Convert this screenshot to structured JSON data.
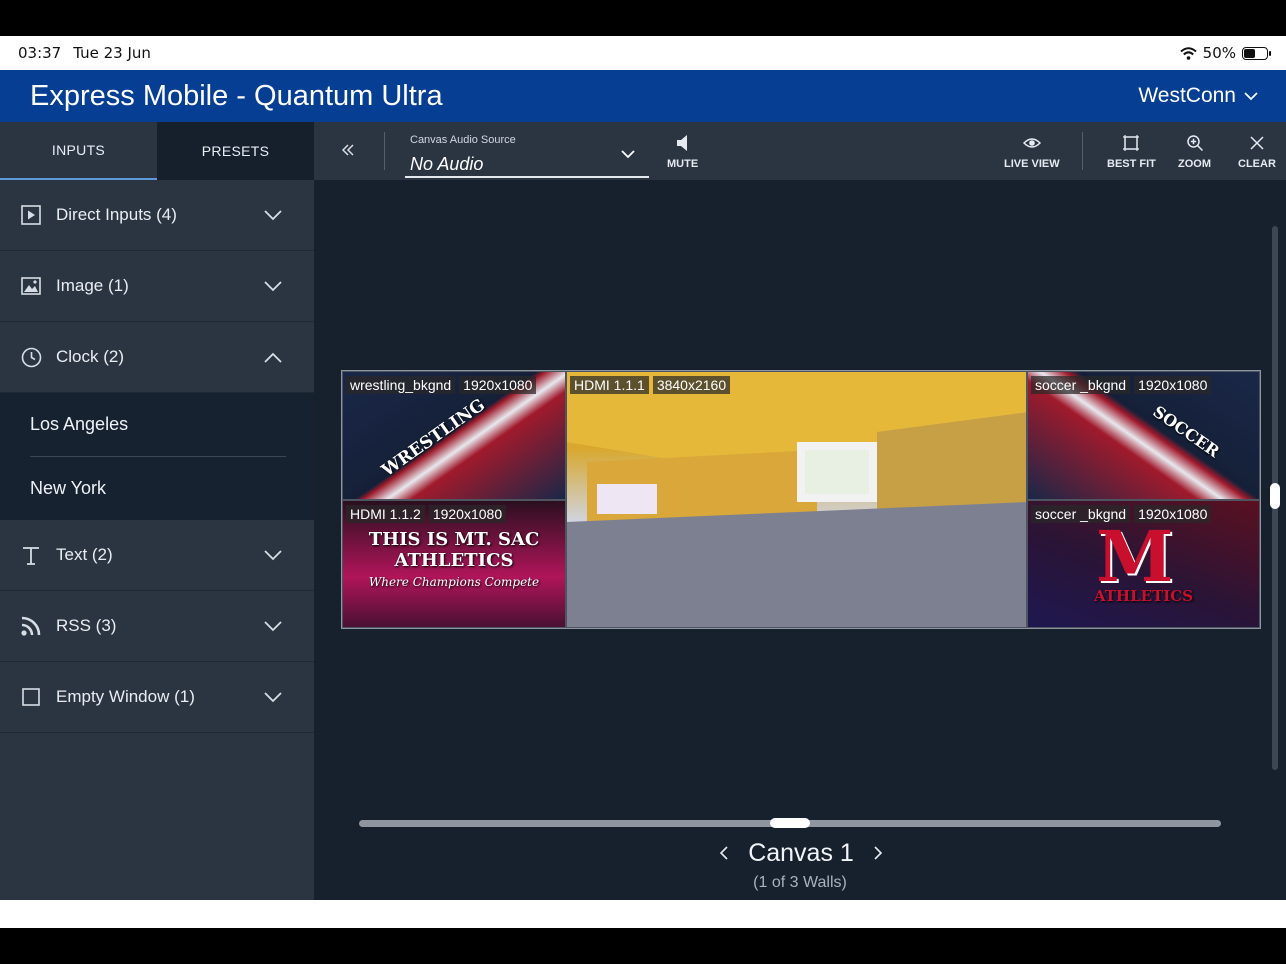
{
  "status": {
    "time": "03:37",
    "date": "Tue 23 Jun",
    "battery": "50%",
    "battery_level": 0.5
  },
  "app": {
    "title": "Express Mobile - Quantum Ultra",
    "account": "WestConn"
  },
  "tabs": [
    {
      "label": "INPUTS",
      "active": true
    },
    {
      "label": "PRESETS",
      "active": false
    }
  ],
  "categories": [
    {
      "label": "Direct Inputs (4)",
      "icon": "play-box-icon",
      "expanded": false
    },
    {
      "label": "Image (1)",
      "icon": "image-icon",
      "expanded": false
    },
    {
      "label": "Clock (2)",
      "icon": "clock-icon",
      "expanded": true,
      "items": [
        "Los Angeles",
        "New York"
      ]
    },
    {
      "label": "Text (2)",
      "icon": "text-icon",
      "expanded": false
    },
    {
      "label": "RSS (3)",
      "icon": "rss-icon",
      "expanded": false
    },
    {
      "label": "Empty Window (1)",
      "icon": "empty-window-icon",
      "expanded": false
    }
  ],
  "toolbar": {
    "audio_label": "Canvas Audio Source",
    "audio_value": "No Audio",
    "mute": "MUTE",
    "live_view": "LIVE VIEW",
    "best_fit": "BEST FIT",
    "zoom": "ZOOM",
    "clear": "CLEAR"
  },
  "windows": [
    {
      "name": "wrestling_bkgnd",
      "res": "1920x1080",
      "art": "WRESTLING"
    },
    {
      "name": "HDMI 1.1.2",
      "res": "1920x1080",
      "art": "THIS IS MT. SAC ATHLETICS",
      "tagline": "Where Champions Compete"
    },
    {
      "name": "HDMI 1.1.1",
      "res": "3840x2160"
    },
    {
      "name": "soccer _bkgnd",
      "res": "1920x1080",
      "art": "SOCCER"
    },
    {
      "name": "soccer _bkgnd",
      "res": "1920x1080",
      "art": "ATHLETICS"
    }
  ],
  "canvas": {
    "name": "Canvas 1",
    "walls": "(1 of 3 Walls)"
  },
  "colors": {
    "appbar": "#053e92",
    "sidebar": "#2b3542",
    "workarea": "#17212d",
    "accent": "#5b9bdc"
  }
}
